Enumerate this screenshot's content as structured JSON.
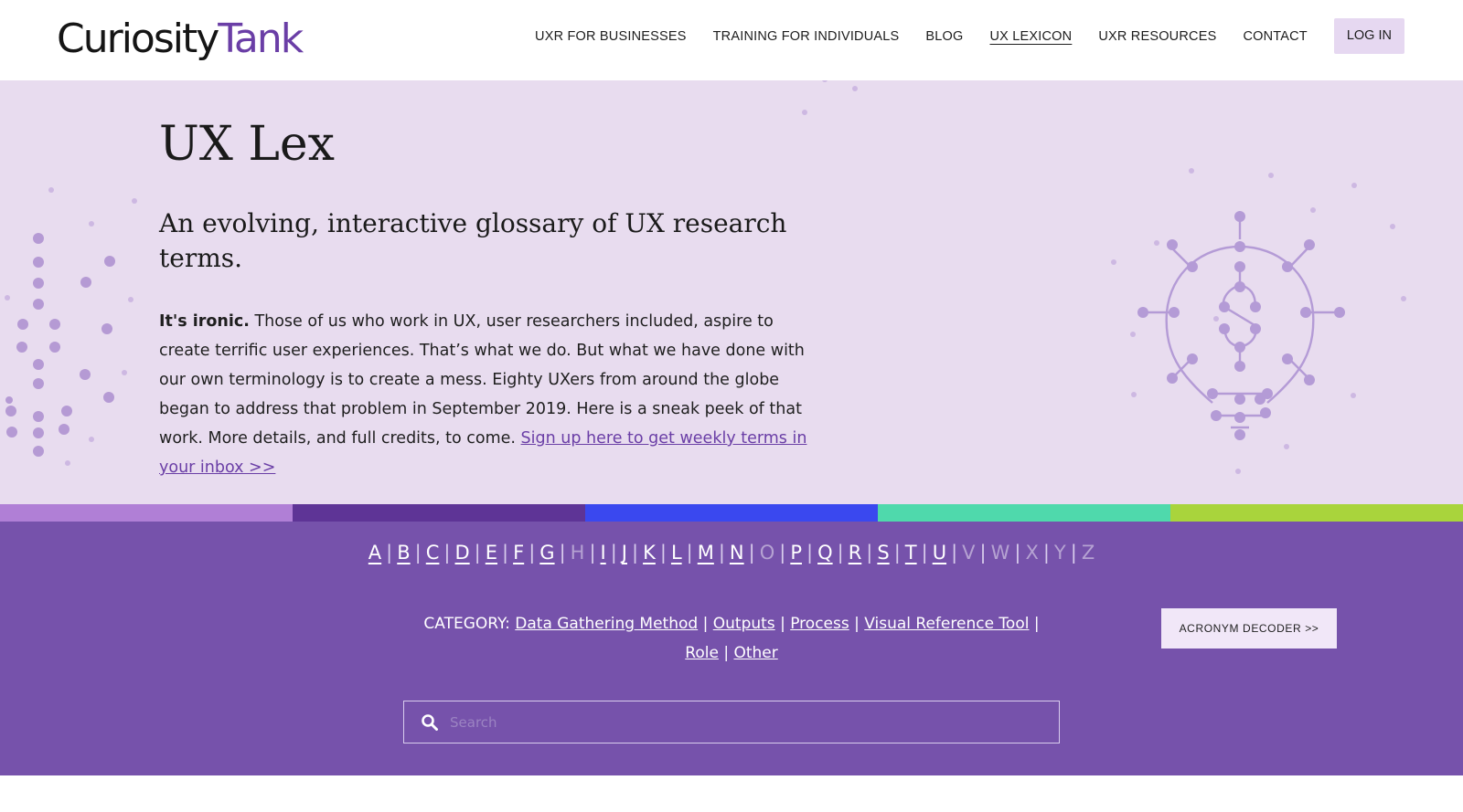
{
  "header": {
    "logo_part1": "Curiosity",
    "logo_part2": "Tank",
    "nav": [
      {
        "label": "UXR FOR BUSINESSES"
      },
      {
        "label": "TRAINING FOR INDIVIDUALS"
      },
      {
        "label": "BLOG"
      },
      {
        "label": "UX LEXICON"
      },
      {
        "label": "UXR RESOURCES"
      },
      {
        "label": "CONTACT"
      }
    ],
    "login_label": "LOG IN"
  },
  "hero": {
    "title": "UX Lex",
    "subtitle": "An evolving, interactive glossary of UX research terms.",
    "lead_bold": "It's ironic.",
    "body": " Those of us who work in UX, user researchers included, aspire to create terrific user experiences. That’s what we do. But what we have done with our own terminology is to create a mess. Eighty UXers from around the globe began to address that problem in September 2019. Here is a sneak peek of that work. More details, and full credits, to come. ",
    "signup_link": "Sign up here to get weekly terms in your inbox >>"
  },
  "colors": {
    "stripe": [
      "#b07fd6",
      "#5e3496",
      "#3a48ef",
      "#4fd9ac",
      "#a9d43c"
    ],
    "brand_purple": "#7652ab",
    "hero_bg": "#e8dcef"
  },
  "alphabet": {
    "letters": [
      {
        "ch": "A",
        "on": true
      },
      {
        "ch": "B",
        "on": true
      },
      {
        "ch": "C",
        "on": true
      },
      {
        "ch": "D",
        "on": true
      },
      {
        "ch": "E",
        "on": true
      },
      {
        "ch": "F",
        "on": true
      },
      {
        "ch": "G",
        "on": true
      },
      {
        "ch": "H",
        "on": false
      },
      {
        "ch": "I",
        "on": true
      },
      {
        "ch": "J",
        "on": true
      },
      {
        "ch": "K",
        "on": true
      },
      {
        "ch": "L",
        "on": true
      },
      {
        "ch": "M",
        "on": true
      },
      {
        "ch": "N",
        "on": true
      },
      {
        "ch": "O",
        "on": false
      },
      {
        "ch": "P",
        "on": true
      },
      {
        "ch": "Q",
        "on": true
      },
      {
        "ch": "R",
        "on": true
      },
      {
        "ch": "S",
        "on": true
      },
      {
        "ch": "T",
        "on": true
      },
      {
        "ch": "U",
        "on": true
      },
      {
        "ch": "V",
        "on": false
      },
      {
        "ch": "W",
        "on": false
      },
      {
        "ch": "X",
        "on": false
      },
      {
        "ch": "Y",
        "on": false
      },
      {
        "ch": "Z",
        "on": false
      }
    ],
    "separator": "|"
  },
  "category": {
    "label": "CATEGORY:",
    "items": [
      "Data Gathering Method",
      "Outputs",
      "Process",
      "Visual Reference Tool",
      "Role",
      "Other"
    ],
    "separator": "|"
  },
  "acronym_button": "ACRONYM DECODER >>",
  "search": {
    "placeholder": "Search",
    "value": "",
    "icon": "search-icon"
  }
}
